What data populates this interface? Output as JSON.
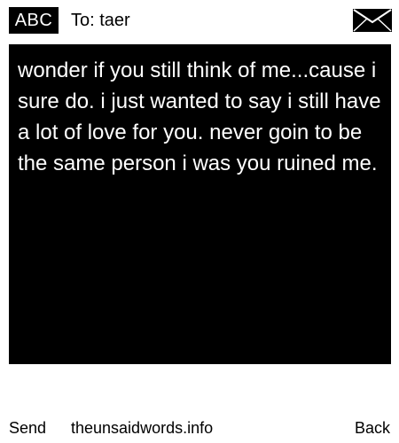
{
  "header": {
    "mode_label": "ABC",
    "recipient": "To: taer",
    "icon": "envelope-icon"
  },
  "message": {
    "body": "wonder if you still think of me...cause i sure do. i just wanted to say i still have a lot of love for you. never goin to be the same person i was you ruined me."
  },
  "footer": {
    "send_label": "Send",
    "site_label": "theunsaidwords.info",
    "back_label": "Back"
  },
  "colors": {
    "background": "#ffffff",
    "message_background": "#000000",
    "message_text": "#ffffff",
    "text": "#000000"
  }
}
